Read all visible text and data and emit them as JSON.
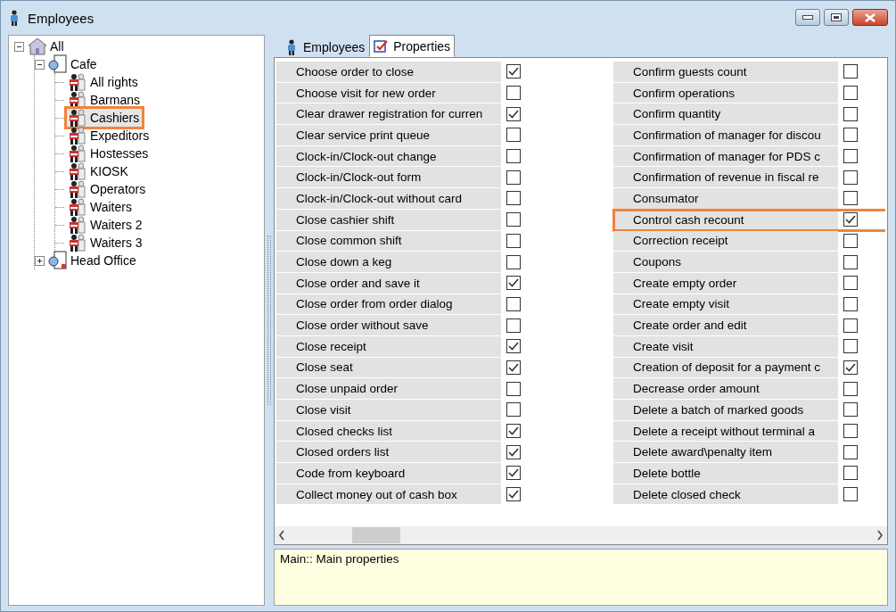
{
  "window": {
    "title": "Employees"
  },
  "tree": [
    {
      "label": "All",
      "kind": "root",
      "expanded": true,
      "selected": false,
      "highlighted": false,
      "children": [
        {
          "label": "Cafe",
          "kind": "group",
          "expanded": true,
          "selected": false,
          "highlighted": false,
          "children": [
            {
              "label": "All rights",
              "kind": "role",
              "selected": false,
              "highlighted": false
            },
            {
              "label": "Barmans",
              "kind": "role",
              "selected": false,
              "highlighted": false
            },
            {
              "label": "Cashiers",
              "kind": "role",
              "selected": true,
              "highlighted": true
            },
            {
              "label": "Expeditors",
              "kind": "role",
              "selected": false,
              "highlighted": false
            },
            {
              "label": "Hostesses",
              "kind": "role",
              "selected": false,
              "highlighted": false
            },
            {
              "label": "KIOSK",
              "kind": "role",
              "selected": false,
              "highlighted": false
            },
            {
              "label": "Operators",
              "kind": "role",
              "selected": false,
              "highlighted": false
            },
            {
              "label": "Waiters",
              "kind": "role",
              "selected": false,
              "highlighted": false
            },
            {
              "label": "Waiters 2",
              "kind": "role",
              "selected": false,
              "highlighted": false
            },
            {
              "label": "Waiters 3",
              "kind": "role",
              "selected": false,
              "highlighted": false
            }
          ]
        },
        {
          "label": "Head Office",
          "kind": "office",
          "expanded": false,
          "selected": false,
          "highlighted": false
        }
      ]
    }
  ],
  "tabs": [
    {
      "label": "Employees",
      "kind": "person",
      "selected": false
    },
    {
      "label": "Properties",
      "kind": "check",
      "selected": true
    }
  ],
  "properties": {
    "columns": [
      {
        "rows": [
          {
            "label": "Choose order to close",
            "checked": true,
            "highlighted": false
          },
          {
            "label": "Choose visit for new order",
            "checked": false,
            "highlighted": false
          },
          {
            "label": "Clear drawer registration for curren",
            "checked": true,
            "highlighted": false
          },
          {
            "label": "Clear service print queue",
            "checked": false,
            "highlighted": false
          },
          {
            "label": "Clock-in/Clock-out change",
            "checked": false,
            "highlighted": false
          },
          {
            "label": "Clock-in/Clock-out form",
            "checked": false,
            "highlighted": false
          },
          {
            "label": "Clock-in/Clock-out without card",
            "checked": false,
            "highlighted": false
          },
          {
            "label": "Close cashier shift",
            "checked": false,
            "highlighted": false
          },
          {
            "label": "Close common shift",
            "checked": false,
            "highlighted": false
          },
          {
            "label": "Close down a keg",
            "checked": false,
            "highlighted": false
          },
          {
            "label": "Close order and save it",
            "checked": true,
            "highlighted": false
          },
          {
            "label": "Close order from order dialog",
            "checked": false,
            "highlighted": false
          },
          {
            "label": "Close order without save",
            "checked": false,
            "highlighted": false
          },
          {
            "label": "Close receipt",
            "checked": true,
            "highlighted": false
          },
          {
            "label": "Close seat",
            "checked": true,
            "highlighted": false
          },
          {
            "label": "Close unpaid order",
            "checked": false,
            "highlighted": false
          },
          {
            "label": "Close visit",
            "checked": false,
            "highlighted": false
          },
          {
            "label": "Closed checks list",
            "checked": true,
            "highlighted": false
          },
          {
            "label": "Closed orders list",
            "checked": true,
            "highlighted": false
          },
          {
            "label": "Code from keyboard",
            "checked": true,
            "highlighted": false
          },
          {
            "label": "Collect money out of cash box",
            "checked": true,
            "highlighted": false
          }
        ]
      },
      {
        "rows": [
          {
            "label": "Confirm guests count",
            "checked": false,
            "highlighted": false
          },
          {
            "label": "Confirm operations",
            "checked": false,
            "highlighted": false
          },
          {
            "label": "Confirm quantity",
            "checked": false,
            "highlighted": false
          },
          {
            "label": "Confirmation of manager for discou",
            "checked": false,
            "highlighted": false
          },
          {
            "label": "Confirmation of manager for PDS c",
            "checked": false,
            "highlighted": false
          },
          {
            "label": "Confirmation of revenue in fiscal re",
            "checked": false,
            "highlighted": false
          },
          {
            "label": "Consumator",
            "checked": false,
            "highlighted": false
          },
          {
            "label": "Control cash recount",
            "checked": true,
            "highlighted": true
          },
          {
            "label": "Correction receipt",
            "checked": false,
            "highlighted": false
          },
          {
            "label": "Coupons",
            "checked": false,
            "highlighted": false
          },
          {
            "label": "Create empty order",
            "checked": false,
            "highlighted": false
          },
          {
            "label": "Create empty visit",
            "checked": false,
            "highlighted": false
          },
          {
            "label": "Create order and edit",
            "checked": false,
            "highlighted": false
          },
          {
            "label": "Create visit",
            "checked": false,
            "highlighted": false
          },
          {
            "label": "Creation of deposit for a payment c",
            "checked": true,
            "highlighted": false
          },
          {
            "label": "Decrease order amount",
            "checked": false,
            "highlighted": false
          },
          {
            "label": "Delete a batch of marked goods",
            "checked": false,
            "highlighted": false
          },
          {
            "label": "Delete a receipt without terminal a",
            "checked": false,
            "highlighted": false
          },
          {
            "label": "Delete award\\penalty item",
            "checked": false,
            "highlighted": false
          },
          {
            "label": "Delete bottle",
            "checked": false,
            "highlighted": false
          },
          {
            "label": "Delete closed check",
            "checked": false,
            "highlighted": false
          }
        ]
      }
    ]
  },
  "description": "Main:: Main properties"
}
